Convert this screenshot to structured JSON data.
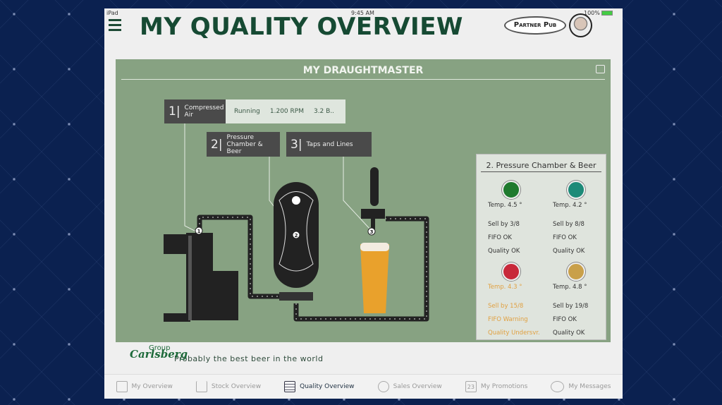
{
  "status": {
    "device": "iPad",
    "time": "9:45 AM",
    "battery": "100%"
  },
  "header": {
    "title": "MY QUALITY OVERVIEW",
    "partner": "Partner Pub"
  },
  "panel": {
    "title": "MY DRAUGHTMASTER",
    "labels": [
      {
        "num": "1|",
        "text": "Compressed Air"
      },
      {
        "num": "2|",
        "text": "Pressure Chamber & Beer"
      },
      {
        "num": "3|",
        "text": "Taps and Lines"
      }
    ],
    "compressor_status": [
      "Running",
      "1.200 RPM",
      "3.2 B.."
    ],
    "markers": [
      "1",
      "2",
      "3"
    ],
    "card": {
      "title": "2. Pressure Chamber & Beer",
      "beers": [
        {
          "temp": "Temp. 4.5 °",
          "sell": "Sell by 3/8",
          "fifo": "FIFO OK",
          "quality": "Quality OK",
          "warn": false,
          "color": "#1f7a2e"
        },
        {
          "temp": "Temp. 4.2 °",
          "sell": "Sell by 8/8",
          "fifo": "FIFO OK",
          "quality": "Quality OK",
          "warn": false,
          "color": "#1d8a78"
        },
        {
          "temp": "Temp. 4.3 °",
          "sell": "Sell by 15/8",
          "fifo": "FIFO Warning",
          "quality": "Quality Undersvr.",
          "warn": true,
          "color": "#c8283a"
        },
        {
          "temp": "Temp. 4.8 °",
          "sell": "Sell by 19/8",
          "fifo": "FIFO OK",
          "quality": "Quality OK",
          "warn": false,
          "color": "#c9a04a"
        }
      ]
    }
  },
  "footer": {
    "brand": "Carlsberg",
    "brand_sub": "Group",
    "slogan": "Probably the best beer in the world"
  },
  "tabs": [
    {
      "label": "My Overview",
      "icon": "presentation-icon"
    },
    {
      "label": "Stock Overview",
      "icon": "cart-icon"
    },
    {
      "label": "Quality Overview",
      "icon": "checklist-icon",
      "active": true
    },
    {
      "label": "Sales Overview",
      "icon": "target-icon"
    },
    {
      "label": "My Promotions",
      "icon": "calendar-icon",
      "day": "23"
    },
    {
      "label": "My Messages",
      "icon": "chat-bubble-icon"
    }
  ]
}
